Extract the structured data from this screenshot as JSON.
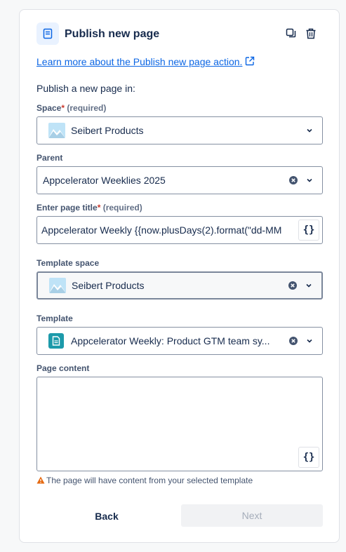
{
  "header": {
    "title": "Publish new page",
    "icons": {
      "app": "page-icon",
      "duplicate": "copy-icon",
      "delete": "trash-icon"
    }
  },
  "learn_link": "Learn more about the Publish new page action.",
  "intro": "Publish a new page in:",
  "fields": {
    "space": {
      "label": "Space",
      "required": "(required)",
      "value": "Seibert Products"
    },
    "parent": {
      "label": "Parent",
      "value": "Appcelerator Weeklies 2025"
    },
    "page_title": {
      "label": "Enter page title",
      "required": "(required)",
      "value": "Appcelerator Weekly {{now.plusDays(2).format(\"dd-MM"
    },
    "template_space": {
      "label": "Template space",
      "value": "Seibert Products"
    },
    "template": {
      "label": "Template",
      "value": "Appcelerator Weekly: Product GTM team sy..."
    },
    "page_content": {
      "label": "Page content",
      "value": ""
    }
  },
  "required_star": "*",
  "brace_label": "{}",
  "warning": "The page will have content from your selected template",
  "buttons": {
    "back": "Back",
    "next": "Next"
  },
  "colors": {
    "link": "#0c66e4",
    "required": "#c9372c",
    "warning": "#e56910",
    "template_icon": "#1d9aaa"
  }
}
